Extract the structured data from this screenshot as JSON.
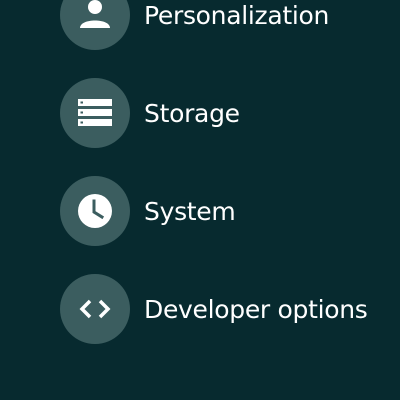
{
  "settings_list": {
    "items": [
      {
        "label": "Personalization",
        "icon": "person-icon"
      },
      {
        "label": "Storage",
        "icon": "storage-icon"
      },
      {
        "label": "System",
        "icon": "clock-icon"
      },
      {
        "label": "Developer options",
        "icon": "code-brackets-icon"
      }
    ]
  },
  "colors": {
    "background": "#072a2f",
    "icon_circle": "#3b5d5f",
    "icon_glyph": "#ffffff",
    "text": "#ffffff"
  }
}
